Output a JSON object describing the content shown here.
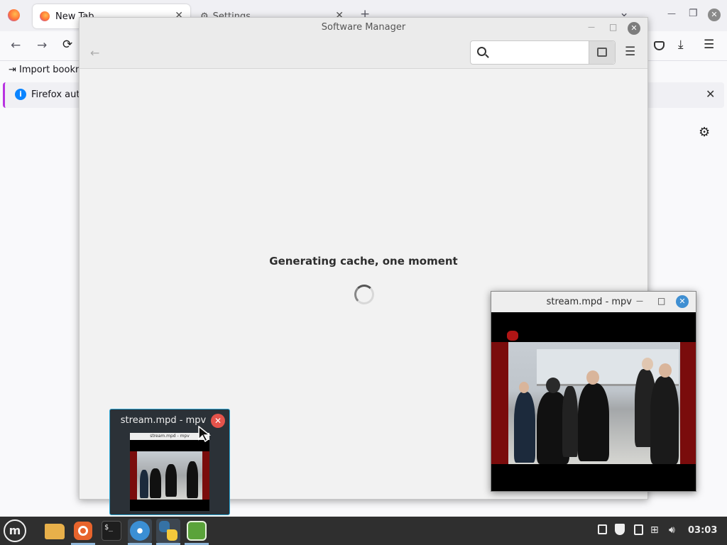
{
  "firefox": {
    "tabs": [
      {
        "label": "New Tab",
        "active": true
      },
      {
        "label": "Settings",
        "active": false
      }
    ],
    "bookmarks_toolbar": {
      "import_label": "Import bookm"
    },
    "notice": {
      "text": "Firefox auto"
    },
    "icons": {
      "firefox_logo": "firefox-icon",
      "back": "←",
      "forward": "→",
      "reload": "⟳",
      "pocket": "pocket-icon",
      "downloads": "⤓",
      "menu": "☰",
      "settings": "⚙",
      "minimize": "—",
      "restore": "❐",
      "close": "✕",
      "new_tab": "+",
      "list_tabs": "⌄"
    }
  },
  "software_manager": {
    "title": "Software Manager",
    "status_message": "Generating cache, one moment",
    "search_placeholder": "",
    "controls": {
      "minimize": "—",
      "maximize": "□",
      "close": "✕",
      "back": "←",
      "menu": "☰",
      "search": "⌕"
    }
  },
  "mpv_window": {
    "title": "stream.mpd - mpv",
    "controls": {
      "minimize": "—",
      "maximize": "□",
      "close": "✕"
    }
  },
  "alt_tab_preview": {
    "title": "stream.mpd - mpv",
    "close": "✕",
    "mini_title": "stream.mpd - mpv"
  },
  "taskbar": {
    "menu_icon": "linux-mint-menu-icon",
    "apps": [
      {
        "name": "files",
        "icon": "folder-icon",
        "color": "#e8b04a"
      },
      {
        "name": "firefox",
        "icon": "firefox-icon",
        "color": "#e8642c"
      },
      {
        "name": "terminal",
        "icon": "terminal-icon",
        "color": "#1e1e1e",
        "glyph": "$_"
      },
      {
        "name": "software-manager",
        "icon": "mintinstall-icon",
        "color": "#3b8fd4"
      },
      {
        "name": "python",
        "icon": "python-icon",
        "color": "#3572a5"
      },
      {
        "name": "mpv",
        "icon": "mpv-icon",
        "color": "#5aa33a"
      }
    ],
    "tray": {
      "icons": [
        "update-manager-icon",
        "shield-icon",
        "clipboard-icon",
        "network-icon",
        "volume-icon"
      ],
      "clock": "03:03"
    }
  },
  "colors": {
    "accent": "#2aa7d6",
    "close_red": "#e5534b",
    "mpv_close": "#3f8fd2"
  }
}
